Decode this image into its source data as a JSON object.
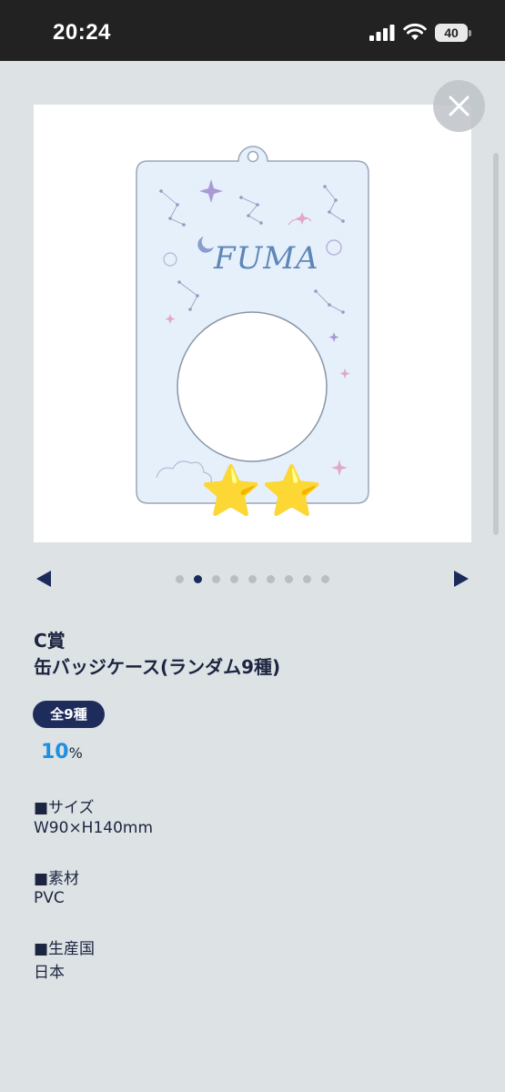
{
  "status_bar": {
    "time": "20:24",
    "battery": "40",
    "icons": [
      "signal-icon",
      "wifi-icon",
      "battery-icon"
    ]
  },
  "modal": {
    "close_icon": "close-icon",
    "image": {
      "card_text": "FUMA",
      "card_color": "#e6f0fb",
      "stars": [
        "⭐",
        "⭐"
      ]
    },
    "carousel": {
      "total": 9,
      "active_index": 1,
      "prev_icon": "triangle-left-icon",
      "next_icon": "triangle-right-icon"
    },
    "prize_title": "C賞",
    "prize_name": "缶バッジケース(ランダム9種)",
    "count_badge": "全9種",
    "rate_value": "10",
    "rate_unit": "%",
    "specs": [
      {
        "label": "■サイズ",
        "value": "W90×H140mm"
      },
      {
        "label": "■素材",
        "value": "PVC"
      },
      {
        "label": "■生産国",
        "value": "日本"
      }
    ]
  },
  "colors": {
    "accent_navy": "#1e2c5c",
    "rate_blue": "#1f8fe0",
    "background": "#dde2e5"
  }
}
